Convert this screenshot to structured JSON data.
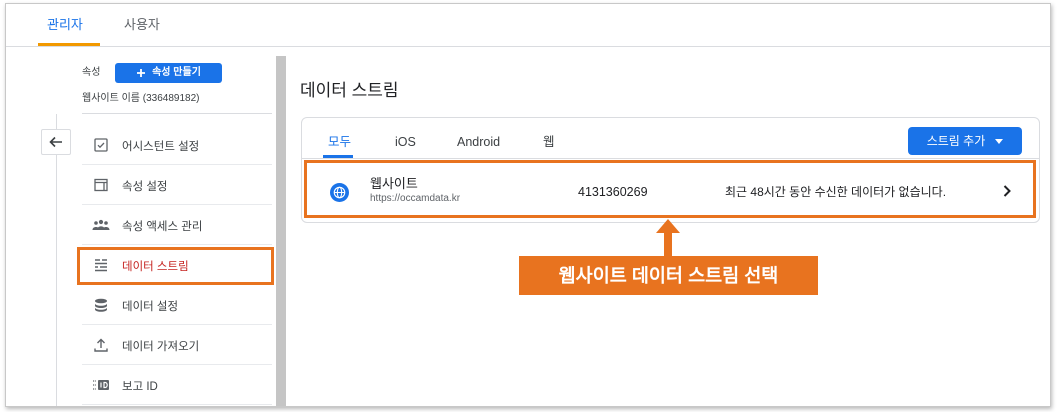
{
  "top_tabs": [
    {
      "label": "관리자",
      "active": true
    },
    {
      "label": "사용자",
      "active": false
    }
  ],
  "sidebar": {
    "property_label": "속성",
    "create_property_label": "속성 만들기",
    "create_property_icon": "plus-icon",
    "property_name": "웹사이트 이름 (336489182)",
    "back_icon": "arrow-left-icon",
    "items": [
      {
        "label": "어시스턴트 설정",
        "icon": "checkbox-icon",
        "active": false
      },
      {
        "label": "속성 설정",
        "icon": "window-icon",
        "active": false
      },
      {
        "label": "속성 액세스 관리",
        "icon": "people-icon",
        "active": false
      },
      {
        "label": "데이터 스트림",
        "icon": "data-streams-icon",
        "active": true
      },
      {
        "label": "데이터 설정",
        "icon": "database-icon",
        "active": false
      },
      {
        "label": "데이터 가져오기",
        "icon": "upload-icon",
        "active": false
      },
      {
        "label": "보고 ID",
        "icon": "reporting-id-icon",
        "active": false
      }
    ]
  },
  "main": {
    "title": "데이터 스트림",
    "filter_tabs": [
      {
        "label": "모두",
        "active": true
      },
      {
        "label": "iOS",
        "active": false
      },
      {
        "label": "Android",
        "active": false
      },
      {
        "label": "웹",
        "active": false
      }
    ],
    "add_stream_button": {
      "label": "스트림 추가",
      "icon": "caret-down-icon"
    },
    "streams": [
      {
        "name": "웹사이트",
        "url": "https://occamdata.kr",
        "stream_id": "4131360269",
        "status": "최근 48시간 동안 수신한 데이터가 없습니다.",
        "icon": "globe-icon",
        "action_icon": "chevron-right-icon"
      }
    ]
  },
  "annotation": {
    "callout_text": "웹사이트 데이터 스트림 선택",
    "arrow_icon": "arrow-up-icon"
  },
  "colors": {
    "accent": "#1a73e8",
    "active_nav_text": "#c5221f",
    "annotation_orange": "#e8731f",
    "tab_indicator": "#f29900"
  }
}
